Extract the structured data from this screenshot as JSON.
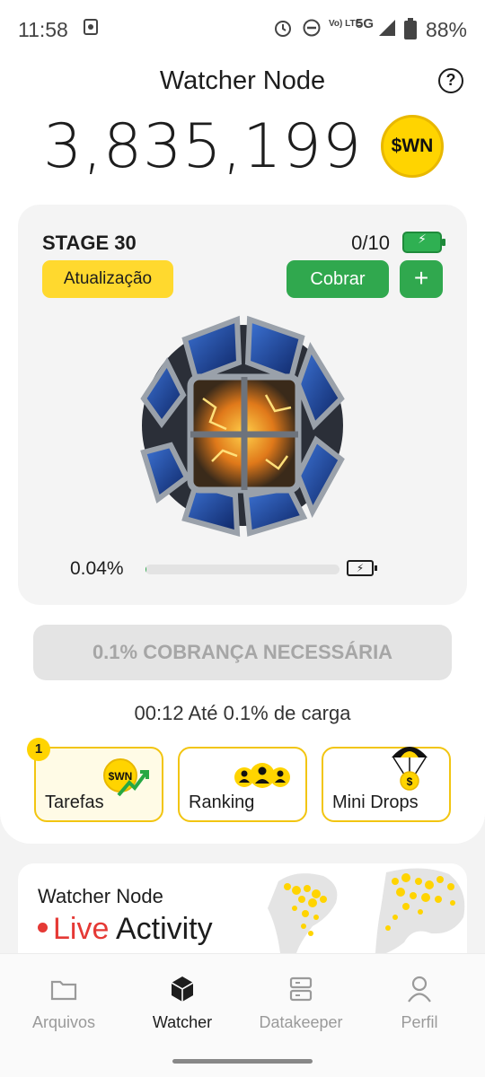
{
  "status_bar": {
    "time": "11:58",
    "network": "5G",
    "volte": "Vo) LTE",
    "battery_pct": "88%"
  },
  "header": {
    "title": "Watcher Node",
    "help_icon": "question-circle-icon"
  },
  "balance": {
    "amount": "3,835,199",
    "coin_label": "$WN",
    "coin_color": "#ffd400"
  },
  "stage_card": {
    "stage_label": "STAGE 30",
    "slots": "0/10",
    "upgrade_label": "Atualização",
    "collect_label": "Cobrar",
    "plus_label": "+",
    "progress_text": "0.04%",
    "progress_value": 0.0004
  },
  "claim_bar": {
    "label": "0.1% COBRANÇA NECESSÁRIA"
  },
  "timer": {
    "text": "00:12  Até 0.1% de carga"
  },
  "tiles": [
    {
      "label": "Tarefas",
      "icon": "wn-coin-arrow-icon",
      "badge": "1"
    },
    {
      "label": "Ranking",
      "icon": "users-group-icon"
    },
    {
      "label": "Mini Drops",
      "icon": "parachute-coin-icon"
    }
  ],
  "live_card": {
    "title": "Watcher Node",
    "live_word": "Live",
    "activity_word": "Activity"
  },
  "nav": {
    "items": [
      {
        "label": "Arquivos",
        "icon": "folder-icon",
        "active": false
      },
      {
        "label": "Watcher",
        "icon": "cube-icon",
        "active": true
      },
      {
        "label": "Datakeeper",
        "icon": "server-icon",
        "active": false
      },
      {
        "label": "Perfil",
        "icon": "user-icon",
        "active": false
      }
    ]
  },
  "colors": {
    "accent_yellow": "#ffd92e",
    "accent_green": "#30a84e",
    "live_red": "#e53935"
  }
}
